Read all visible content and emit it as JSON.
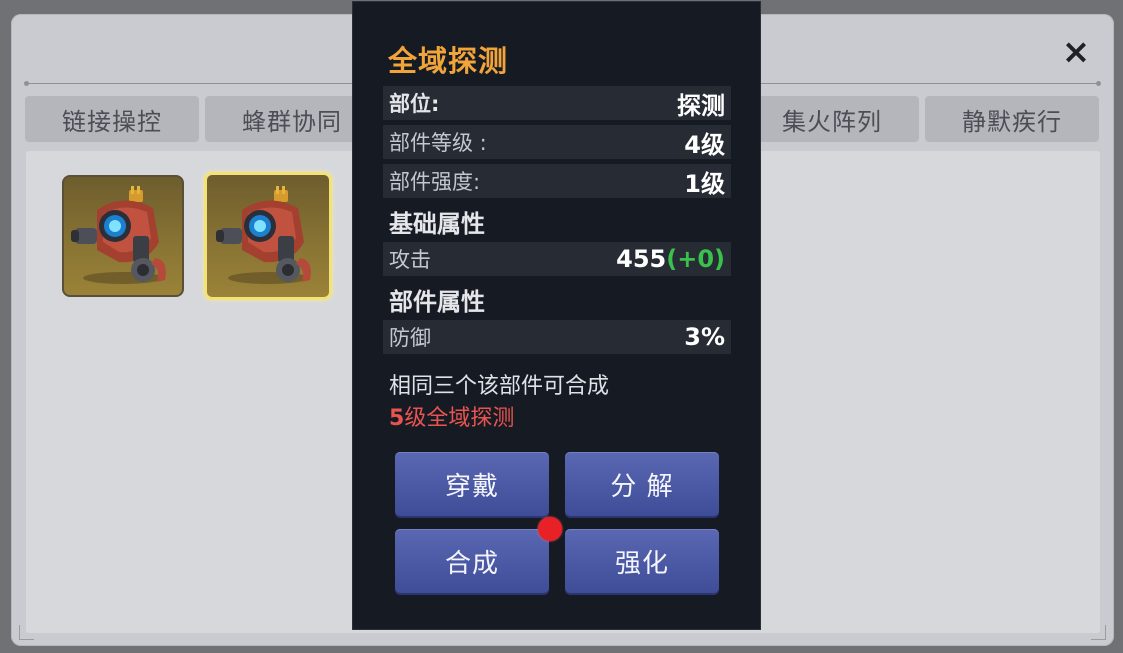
{
  "close_icon": "×",
  "tabs": [
    {
      "label": "链接操控"
    },
    {
      "label": "蜂群协同"
    },
    {
      "label": ""
    },
    {
      "label": ""
    },
    {
      "label": "集火阵列"
    },
    {
      "label": "静默疾行"
    }
  ],
  "inventory": [
    {
      "name": "全域探测",
      "selected": false
    },
    {
      "name": "全域探测",
      "selected": true
    }
  ],
  "detail": {
    "title": "全域探测",
    "part_label": "部位:",
    "part_value": "探测",
    "level_label": "部件等级 :",
    "level_value": "4级",
    "strength_label": "部件强度:",
    "strength_value": "1级",
    "base_section": "基础属性",
    "attack_label": "攻击",
    "attack_value": "455",
    "attack_bonus": "(+0)",
    "part_section": "部件属性",
    "defense_label": "防御",
    "defense_value": "3%",
    "merge_note": "相同三个该部件可合成",
    "merge_result_level": "5",
    "merge_result_text": "级全域探测"
  },
  "buttons": {
    "equip": "穿戴",
    "decompose": "分 解",
    "merge": "合成",
    "enhance": "强化"
  },
  "colors": {
    "title": "#f0a43a",
    "bonus": "#39c14b",
    "merge_result": "#e85450",
    "button": "#4a58a6",
    "notify_dot": "#e82127"
  }
}
